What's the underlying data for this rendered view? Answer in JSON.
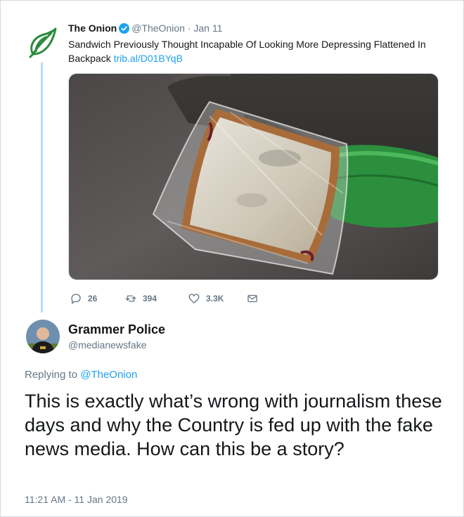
{
  "tweet": {
    "author_name": "The Onion",
    "author_handle": "@TheOnion",
    "separator": "·",
    "date": "Jan 11",
    "text": "Sandwich Previously Thought Incapable Of Looking More Depressing Flattened In Backpack",
    "link": "trib.al/D01BYqB",
    "verified": true,
    "avatar_icon": "onion-logo-icon",
    "brand_color": "#2a8a3c",
    "media_description": "photo",
    "actions": {
      "replies": "26",
      "retweets": "394",
      "likes": "3.3K"
    }
  },
  "reply": {
    "author_name": "Grammer Police",
    "author_handle": "@medianewsfake",
    "replying_prefix": "Replying to",
    "replying_to": "@TheOnion",
    "text": "This is exactly what’s wrong with journalism these days and why the Country is fed up with the fake news media. How can this be a story?",
    "timestamp": "11:21 AM - 11 Jan 2019"
  },
  "colors": {
    "link": "#1da1f2",
    "muted": "#657786",
    "thread_line": "#b5def6",
    "text": "#14171a"
  }
}
